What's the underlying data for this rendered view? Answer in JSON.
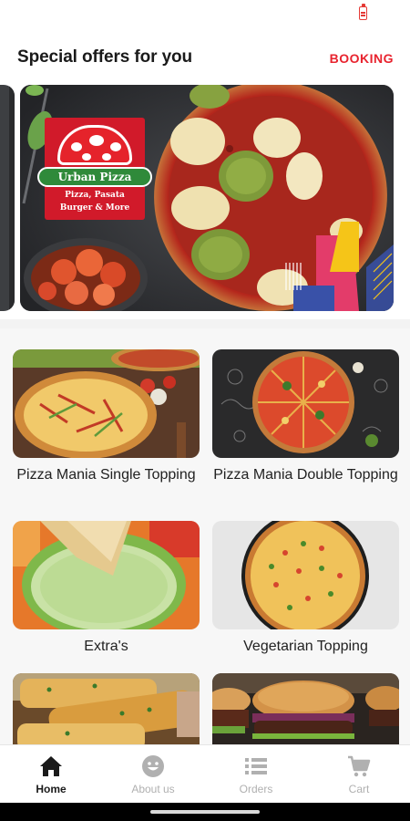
{
  "status_bar": {
    "battery_icon": "battery-icon",
    "accent": "#e53935"
  },
  "header": {
    "title": "Special offers for you",
    "action_label": "BOOKING",
    "action_color": "#e8232e"
  },
  "banner": {
    "logo": {
      "name": "Urban Pizza",
      "tagline_1": "Pizza, Pasata",
      "tagline_2": "Burger & More"
    }
  },
  "categories": [
    {
      "label": "Pizza Mania Single Topping"
    },
    {
      "label": "Pizza Mania Double Topping"
    },
    {
      "label": "Extra's"
    },
    {
      "label": "Vegetarian Topping"
    },
    {
      "label": ""
    },
    {
      "label": ""
    }
  ],
  "bottom_nav": {
    "items": [
      {
        "label": "Home",
        "icon": "home-icon",
        "active": true
      },
      {
        "label": "About us",
        "icon": "smiley-icon",
        "active": false
      },
      {
        "label": "Orders",
        "icon": "list-icon",
        "active": false
      },
      {
        "label": "Cart",
        "icon": "cart-icon",
        "active": false
      }
    ]
  }
}
